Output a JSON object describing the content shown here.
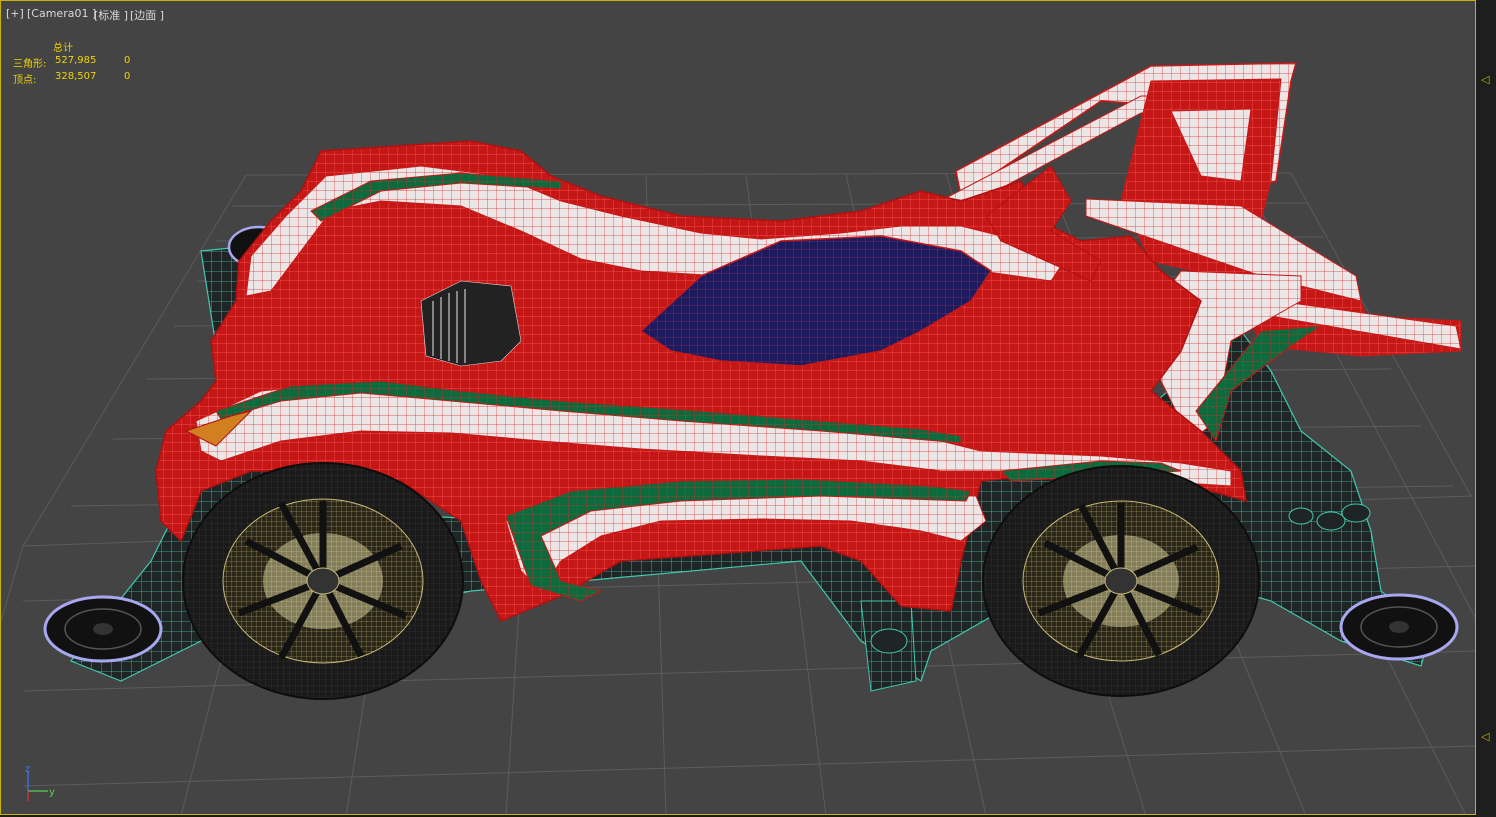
{
  "viewport": {
    "labels": [
      "[+]",
      "[Camera01 ]",
      "[标准 ]",
      "[边面 ]"
    ]
  },
  "stats": {
    "header": "总计",
    "rows": [
      {
        "label": "三角形:",
        "total": "527,985",
        "selected": "0"
      },
      {
        "label": "顶点:",
        "total": "328,507",
        "selected": "0"
      }
    ]
  },
  "axis": {
    "z": "z",
    "y": "y"
  },
  "icons": {
    "scroll_up": "◁",
    "scroll_down": "◁"
  },
  "colors": {
    "background": "#444444",
    "border_active": "#c8b400",
    "stats_text": "#f0d200",
    "body_red": "#c81818",
    "wire_red": "#ff5050",
    "chassis_cyan": "#40c8b0",
    "stripe_green": "#0c6a3c",
    "canopy_blue": "#1e1a5e"
  }
}
